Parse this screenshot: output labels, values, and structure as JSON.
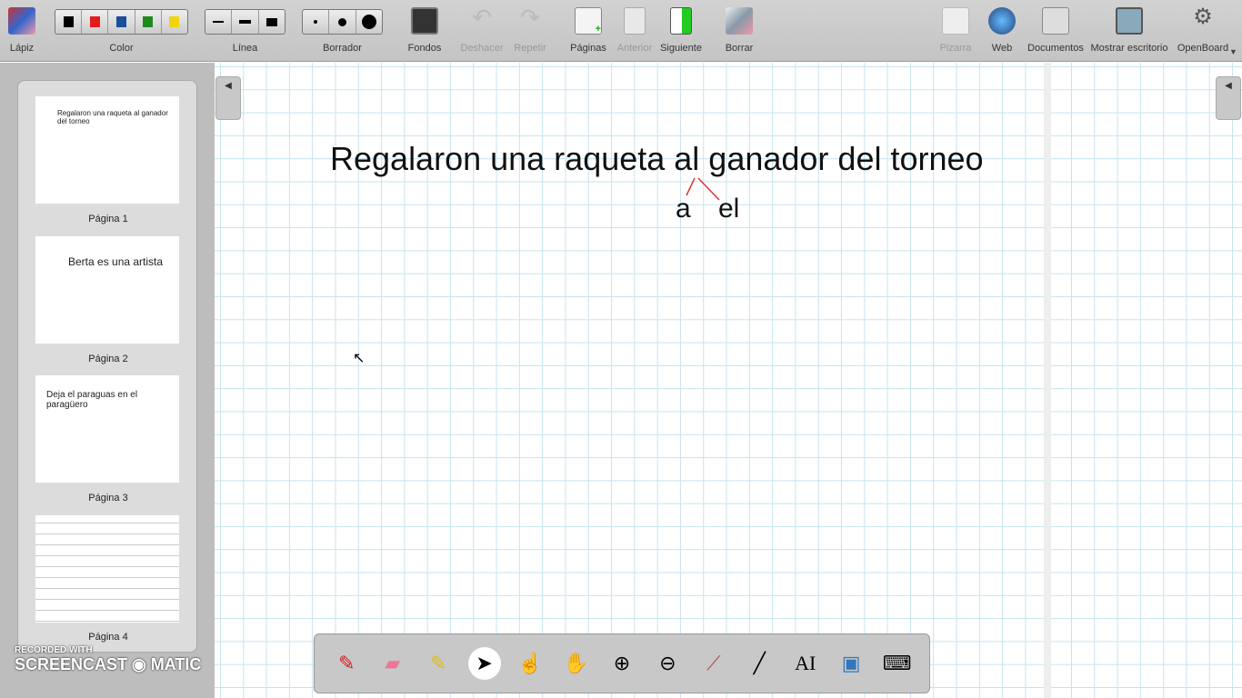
{
  "toolbar": {
    "pencil": "Lápiz",
    "color": "Color",
    "line": "Línea",
    "eraser": "Borrador",
    "backgrounds": "Fondos",
    "undo": "Deshacer",
    "redo": "Repetir",
    "pages": "Páginas",
    "previous": "Anterior",
    "next": "Siguiente",
    "clear": "Borrar",
    "board": "Pizarra",
    "web": "Web",
    "documents": "Documentos",
    "desktop": "Mostrar escritorio",
    "openboard": "OpenBoard",
    "colors": [
      "#000000",
      "#e31b1b",
      "#1a4f9c",
      "#1e8a1e",
      "#f2d40c"
    ]
  },
  "pages": [
    {
      "label": "Página 1",
      "text": "Regalaron una raqueta al ganador del torneo"
    },
    {
      "label": "Página 2",
      "text": "Berta es una artista"
    },
    {
      "label": "Página 3",
      "text": "Deja el paraguas en el paragüero"
    },
    {
      "label": "Página 4",
      "text": ""
    }
  ],
  "canvas": {
    "sentence": "Regalaron una raqueta al ganador del torneo",
    "split_a": "a",
    "split_el": "el"
  },
  "watermark": {
    "line1": "RECORDED WITH",
    "line2": "SCREENCAST",
    "line3": "MATIC"
  }
}
